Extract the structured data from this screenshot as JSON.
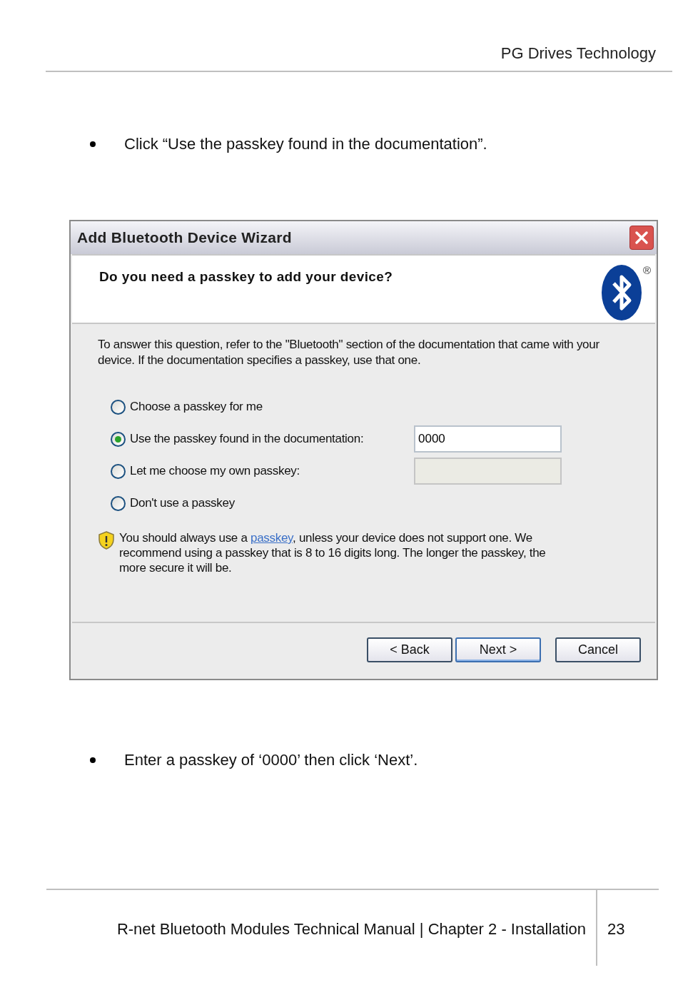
{
  "page_header": "PG Drives Technology",
  "bullets_top": [
    "Click “Use the passkey found in the documentation”."
  ],
  "dialog": {
    "title": "Add Bluetooth Device Wizard",
    "heading": "Do you need a passkey to add your device?",
    "logo_mark": "®",
    "intro": "To answer this question, refer to the \"Bluetooth\" section of the documentation that came with your device. If the documentation specifies a passkey, use that one.",
    "options": [
      {
        "label": "Choose a passkey for me",
        "selected": false
      },
      {
        "label": "Use the passkey found in the documentation:",
        "selected": true,
        "field": {
          "value": "0000",
          "disabled": false
        }
      },
      {
        "label": "Let me choose my own passkey:",
        "selected": false,
        "field": {
          "disabled": true
        }
      },
      {
        "label": "Don't use a passkey",
        "selected": false
      }
    ],
    "note": {
      "before": "You should always use a ",
      "link": "passkey",
      "after": ", unless your device does not support one. We recommend using a passkey that is 8 to 16 digits long. The longer the passkey, the more secure it will be."
    },
    "buttons": [
      {
        "label": "< Back",
        "default": false
      },
      {
        "label": "Next >",
        "default": true
      },
      {
        "label": "Cancel",
        "default": false
      }
    ]
  },
  "bullets_bottom": [
    "Enter a passkey of ‘0000’ then click ‘Next’."
  ],
  "footer": {
    "text": "R-net Bluetooth Modules Technical Manual | Chapter 2 - Installation",
    "page_number": "23"
  }
}
